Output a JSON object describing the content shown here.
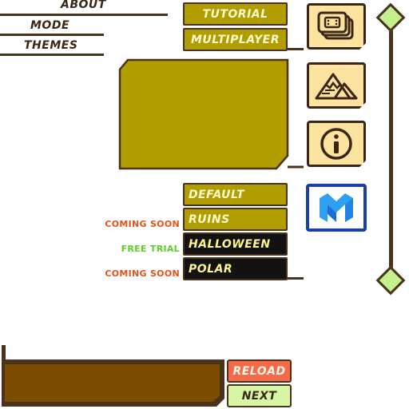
{
  "menu": {
    "about": "ABOUT",
    "mode": "MODE",
    "themes": "THEMES"
  },
  "mode_buttons": {
    "tutorial": "TUTORIAL",
    "multiplayer": "MULTIPLAYER"
  },
  "themes": [
    {
      "label": "DEFAULT",
      "tag": "",
      "style": "olive"
    },
    {
      "label": "RUINS",
      "tag": "COMING SOON",
      "tag_color": "#e0541c",
      "style": "olive"
    },
    {
      "label": "HALLOWEEN",
      "tag": "FREE TRIAL",
      "tag_color": "#5fcf2a",
      "style": "dark"
    },
    {
      "label": "POLAR",
      "tag": "COMING SOON",
      "tag_color": "#e0541c",
      "style": "dark"
    }
  ],
  "icons": {
    "cards": "cards-icon",
    "mountains": "mountains-icon",
    "info": "info-icon",
    "brand": "m-logo-icon"
  },
  "actions": {
    "reload": "RELOAD",
    "next": "NEXT"
  },
  "colors": {
    "olive": "#b19d00",
    "dark_brown": "#4a321c",
    "cream": "#fde3a0",
    "diamond_green": "#c6ef8d",
    "reload_red": "#f56a4a",
    "next_green": "#d8f7a6",
    "brand_blue": "#1a3fa6"
  }
}
